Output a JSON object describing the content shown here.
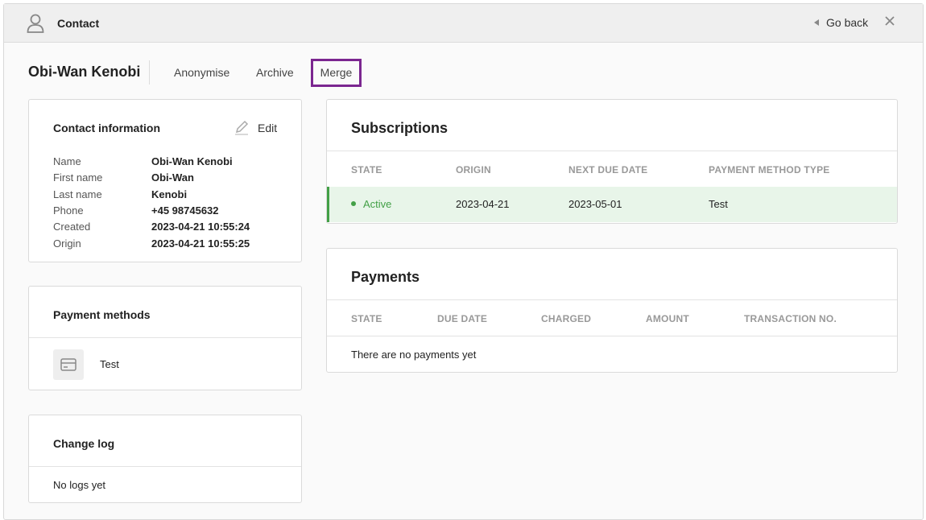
{
  "header": {
    "title": "Contact",
    "go_back_label": "Go back"
  },
  "contact": {
    "name": "Obi-Wan Kenobi",
    "actions": [
      "Anonymise",
      "Archive",
      "Merge"
    ]
  },
  "contact_info": {
    "title": "Contact information",
    "edit_label": "Edit",
    "fields": [
      {
        "label": "Name",
        "value": "Obi-Wan Kenobi"
      },
      {
        "label": "First name",
        "value": "Obi-Wan"
      },
      {
        "label": "Last name",
        "value": "Kenobi"
      },
      {
        "label": "Phone",
        "value": "+45 98745632"
      },
      {
        "label": "Created",
        "value": "2023-04-21 10:55:24"
      },
      {
        "label": "Origin",
        "value": "2023-04-21 10:55:25"
      }
    ]
  },
  "payment_methods": {
    "title": "Payment methods",
    "items": [
      {
        "icon": "credit-card-icon",
        "label": "Test"
      }
    ]
  },
  "change_log": {
    "title": "Change log",
    "empty_text": "No logs yet"
  },
  "subscriptions": {
    "title": "Subscriptions",
    "columns": [
      "STATE",
      "ORIGIN",
      "NEXT DUE DATE",
      "PAYMENT METHOD TYPE"
    ],
    "rows": [
      {
        "state": "Active",
        "origin": "2023-04-21",
        "next_due_date": "2023-05-01",
        "payment_method_type": "Test"
      }
    ]
  },
  "payments": {
    "title": "Payments",
    "columns": [
      "STATE",
      "DUE DATE",
      "CHARGED",
      "AMOUNT",
      "TRANSACTION NO."
    ],
    "empty_text": "There are no payments yet"
  },
  "colors": {
    "accent_highlight": "#7b2690",
    "active_green": "#43a047",
    "active_row_bg": "#e8f5e9"
  }
}
